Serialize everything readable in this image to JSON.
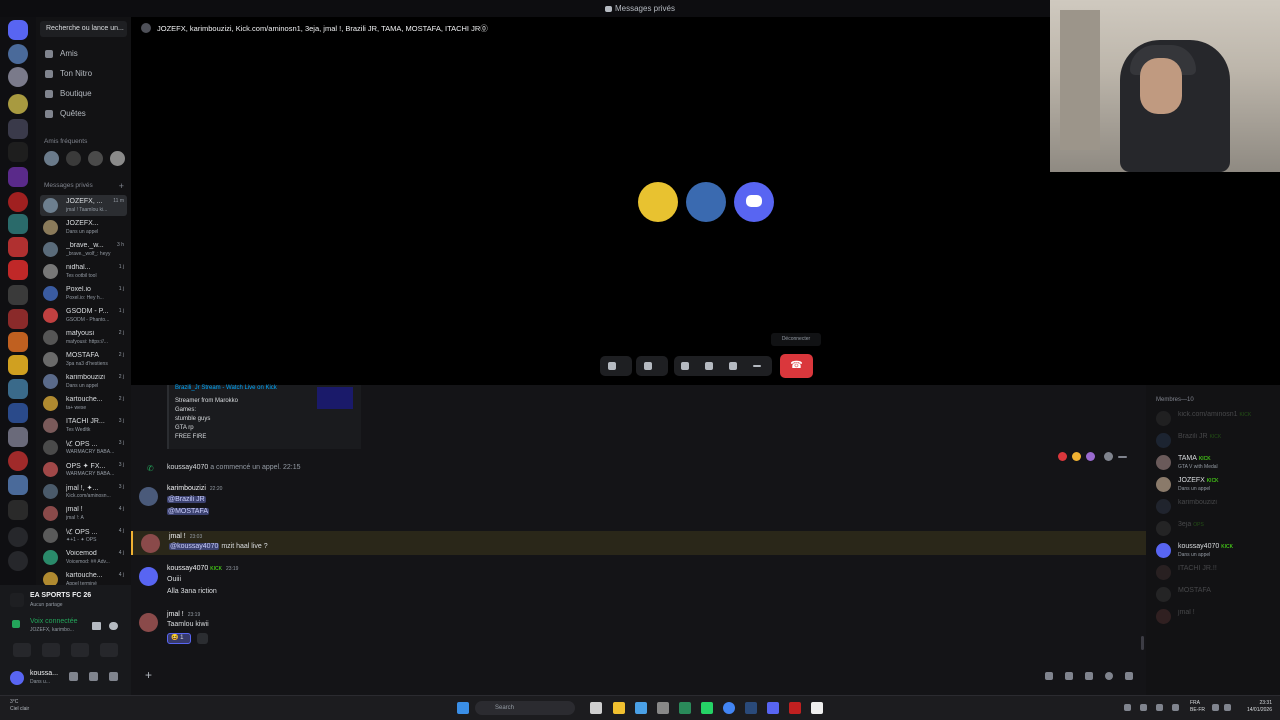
{
  "window": {
    "title": "Messages privés"
  },
  "sidebar": {
    "search_placeholder": "Recherche ou lance un...",
    "nav": [
      {
        "label": "Amis",
        "icon": "friends-icon"
      },
      {
        "label": "Ton Nitro",
        "icon": "nitro-icon"
      },
      {
        "label": "Boutique",
        "icon": "shop-icon"
      },
      {
        "label": "Quêtes",
        "icon": "quests-icon"
      }
    ],
    "frequent_label": "Amis fréquents",
    "dm_label": "Messages privés",
    "dms": [
      {
        "name": "JOZEFX, ...",
        "sub": "jmal ! Taamlou ki...",
        "time": "11 m",
        "color": "#6d7f8f"
      },
      {
        "name": "JOZEFX...",
        "sub": "Dans un appel",
        "time": "",
        "color": "#8a7a5a"
      },
      {
        "name": "_brave._w...",
        "sub": "_brave._wolf_: heyy",
        "time": "3 h",
        "color": "#5a6b7a"
      },
      {
        "name": "nidhal...",
        "sub": "Tes ootbil tool",
        "time": "1 j",
        "color": "#777777"
      },
      {
        "name": "Poxel.io",
        "sub": "Poxel.io: Hey h...",
        "time": "1 j",
        "color": "#3a5ba0"
      },
      {
        "name": "GSODM - P...",
        "sub": "GSODM - Phanto...",
        "time": "1 j",
        "color": "#c04040"
      },
      {
        "name": "mafyousi",
        "sub": "mafyousi: https://...",
        "time": "2 j",
        "color": "#555555"
      },
      {
        "name": "MOSTAFA",
        "sub": "3pa na3 d'hestiens",
        "time": "2 j",
        "color": "#6a6a6a"
      },
      {
        "name": "karimbouzizi",
        "sub": "Dans un appel",
        "time": "2 j",
        "color": "#5a6a8a"
      },
      {
        "name": "kartouche...",
        "sub": "ta+ wese",
        "time": "2 j",
        "color": "#b08a30"
      },
      {
        "name": "ITACHI JR...",
        "sub": "Tes Wedltk",
        "time": "3 j",
        "color": "#7a5a5a"
      },
      {
        "name": "\\ℭ OPS ...",
        "sub": "WARMACRY BABA...",
        "time": "3 j",
        "color": "#4a4a4a"
      },
      {
        "name": "OPS ✦ FX...",
        "sub": "WARMACRY BABA...",
        "time": "3 j",
        "color": "#a04848"
      },
      {
        "name": "jmal !, ✦...",
        "sub": "Kick.com/aminosn...",
        "time": "3 j",
        "color": "#4a5a6a"
      },
      {
        "name": "jmal !",
        "sub": "jmal !: A",
        "time": "4 j",
        "color": "#8a4a4a"
      },
      {
        "name": "\\ℭ OPS ...",
        "sub": "✦+1 - ✦ OPS",
        "time": "4 j",
        "color": "#5a5a5a"
      },
      {
        "name": "Voicemod",
        "sub": "Voicemod: ## Adv...",
        "time": "4 j",
        "color": "#2a8a6a"
      },
      {
        "name": "kartouche...",
        "sub": "Appel terminé",
        "time": "4 j",
        "color": "#b08a30"
      }
    ]
  },
  "bottom": {
    "game_title": "EA SPORTS FC 26",
    "game_sub": "Aucun partage",
    "voice_status": "Voix connectée",
    "voice_sub": "JOZEFX, karimbo...",
    "user_name": "koussa...",
    "user_status": "Dans u..."
  },
  "call": {
    "header": "JOZEFX, karimbouzizi, Kick.com/aminosn1, 3eja, jmal !, Brazili JR, TAMA, MOSTAFA, ITACHI JR⓪",
    "tooltip": "Déconnecter",
    "hangup_glyph": "☎"
  },
  "chat": {
    "embed": {
      "title": "Brazili_Jr Stream - Watch Live on Kick",
      "lines": [
        "Streamer from Marokko",
        "Games:",
        "stumble guys",
        "GTA rp",
        "FREE FIRE"
      ]
    },
    "system": {
      "user": "koussay4070",
      "text": "a commencé un appel.",
      "time": "22:15"
    },
    "messages": [
      {
        "author": "karimbouzizi",
        "time": "22:20",
        "lines": [
          "@Brazili JR",
          "@MOSTAFA"
        ]
      },
      {
        "author": "jmal !",
        "time": "23:03",
        "mention": "@koussay4070",
        "text": "mzit haal live ?"
      },
      {
        "author": "koussay4070",
        "badge": "KICK",
        "time": "23:19",
        "lines": [
          "Ouiii",
          "Alla 3ana riction"
        ]
      },
      {
        "author": "jmal !",
        "time": "23:19",
        "lines": [
          "Taamlou kiwii"
        ],
        "reaction": "1"
      }
    ],
    "composer_plus": "+"
  },
  "members": {
    "header": "Membres—10",
    "list": [
      {
        "name": "kick.com/aminosn1",
        "status": "",
        "badge": "KICK",
        "online": false,
        "color": "#4a4a4a"
      },
      {
        "name": "Brazili JR",
        "status": "",
        "badge": "KICK",
        "online": false,
        "color": "#3a5a8a"
      },
      {
        "name": "TAMA",
        "status": "GTA V with Medal",
        "badge": "KICK",
        "online": true,
        "color": "#6a5a5a"
      },
      {
        "name": "JOZEFX",
        "status": "Dans un appel",
        "badge": "KICK",
        "online": true,
        "color": "#8a7a6a"
      },
      {
        "name": "karimbouzizi",
        "status": "",
        "badge": "",
        "online": false,
        "color": "#4a5a7a"
      },
      {
        "name": "3eja",
        "status": "",
        "badge": "OPS",
        "online": false,
        "color": "#5a5a5a"
      },
      {
        "name": "koussay4070",
        "status": "Dans un appel",
        "badge": "KICK",
        "online": true,
        "color": "#5865f2"
      },
      {
        "name": "ITACHI JR.!!",
        "status": "",
        "badge": "",
        "online": false,
        "color": "#6a4a4a"
      },
      {
        "name": "MOSTAFA",
        "status": "",
        "badge": "",
        "online": false,
        "color": "#5a5a5a"
      },
      {
        "name": "jmal !",
        "status": "",
        "badge": "",
        "online": false,
        "color": "#8a4a4a"
      }
    ]
  },
  "taskbar": {
    "weather_line1": "3°C",
    "weather_line2": "Ciel clair",
    "search_placeholder": "Search",
    "lang_line1": "FRA",
    "lang_line2": "BE-FR",
    "time": "23:31",
    "date": "14/01/2026"
  }
}
